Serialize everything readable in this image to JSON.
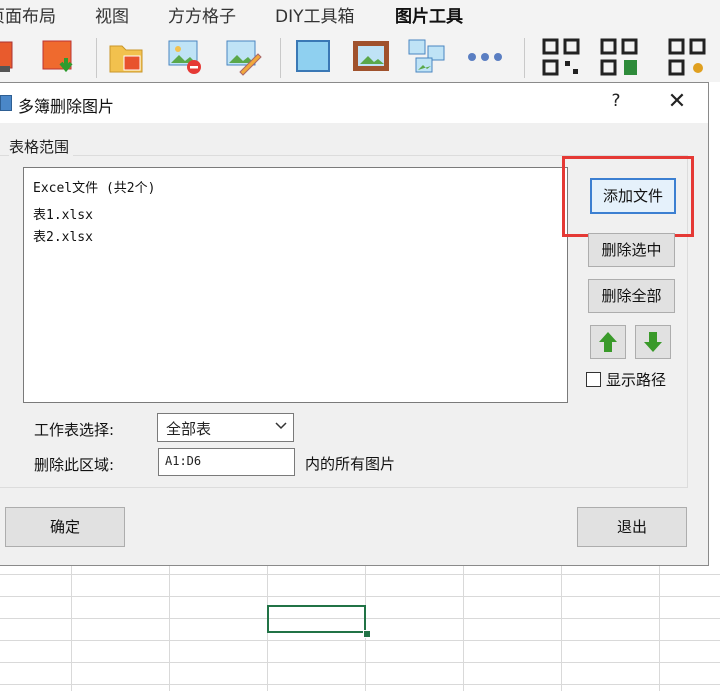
{
  "ribbon": {
    "tabs": [
      {
        "label": "页面布局",
        "active": false
      },
      {
        "label": "视图",
        "active": false
      },
      {
        "label": "方方格子",
        "active": false
      },
      {
        "label": "DIY工具箱",
        "active": false
      },
      {
        "label": "图片工具",
        "active": true
      }
    ],
    "accent_color": "#217346",
    "toolbar_icons": [
      "image-export-icon",
      "image-download-icon",
      "folder-image-icon",
      "image-remove-icon",
      "image-edit-icon",
      "blank-image-icon",
      "framed-picture-icon",
      "multiple-images-icon",
      "more-icon",
      "qr-code-icon",
      "qr-code-sheet-icon",
      "qr-code-settings-icon"
    ]
  },
  "dialog": {
    "title": "多簿删除图片",
    "help_label": "?",
    "close_label": "✕",
    "group_label": "表格范围",
    "file_list": {
      "header": "Excel文件 (共2个)",
      "items": [
        "表1.xlsx",
        "表2.xlsx"
      ]
    },
    "buttons": {
      "add_file": "添加文件",
      "delete_selected": "删除选中",
      "delete_all": "删除全部",
      "ok": "确定",
      "exit": "退出"
    },
    "show_path_label": "显示路径",
    "show_path_checked": false,
    "worksheet_label": "工作表选择:",
    "worksheet_value": "全部表",
    "range_label": "删除此区域:",
    "range_value": "A1:D6",
    "range_suffix": "内的所有图片",
    "highlight_color": "#e53935"
  }
}
